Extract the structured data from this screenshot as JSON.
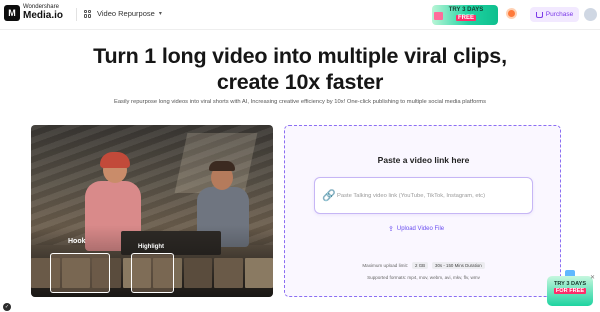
{
  "header": {
    "logo_glyph": "M",
    "brand_top": "Wondershare",
    "brand_main": "Media.io",
    "product_label": "Video Repurpose",
    "product_caret": "▾",
    "promo_line1": "TRY 3 DAYS",
    "promo_free": "FREE",
    "purchase_label": "Purchase"
  },
  "hero": {
    "title_line1": "Turn 1 long video into multiple viral clips,",
    "title_line2": "create 10x faster",
    "subtitle": "Easily repurpose long videos into viral shorts with AI, Increasing creative efficiency by 10x! One-click publishing to multiple social media platforms"
  },
  "video": {
    "hook_label": "Hook",
    "highlight_label": "Highlight"
  },
  "upload": {
    "title": "Paste a video link here",
    "input_placeholder": "Paste Talking video link (YouTube, TikTok, Instagram, etc)",
    "input_value": "",
    "upload_label": "Upload Video File",
    "limit_label": "Maximum upload limit:",
    "limit_size": "2 GB",
    "limit_duration": "30s - 150 Mins Duration",
    "formats_label": "Supported formats: mp4, mov, webm, avi, mkv, flv, wmv"
  },
  "float_promo": {
    "line1": "TRY 3 DAYS",
    "free": "FOR FREE"
  },
  "icons": {
    "link": "link-icon",
    "upload": "upload-icon",
    "grid": "grid-icon",
    "cart": "cart-icon",
    "gift": "gift-icon",
    "close": "close-icon"
  },
  "colors": {
    "accent": "#7b39e8",
    "upload_border": "#8b6ef2",
    "promo_green": "#1fd3a2",
    "promo_pink": "#ff2d6a"
  }
}
